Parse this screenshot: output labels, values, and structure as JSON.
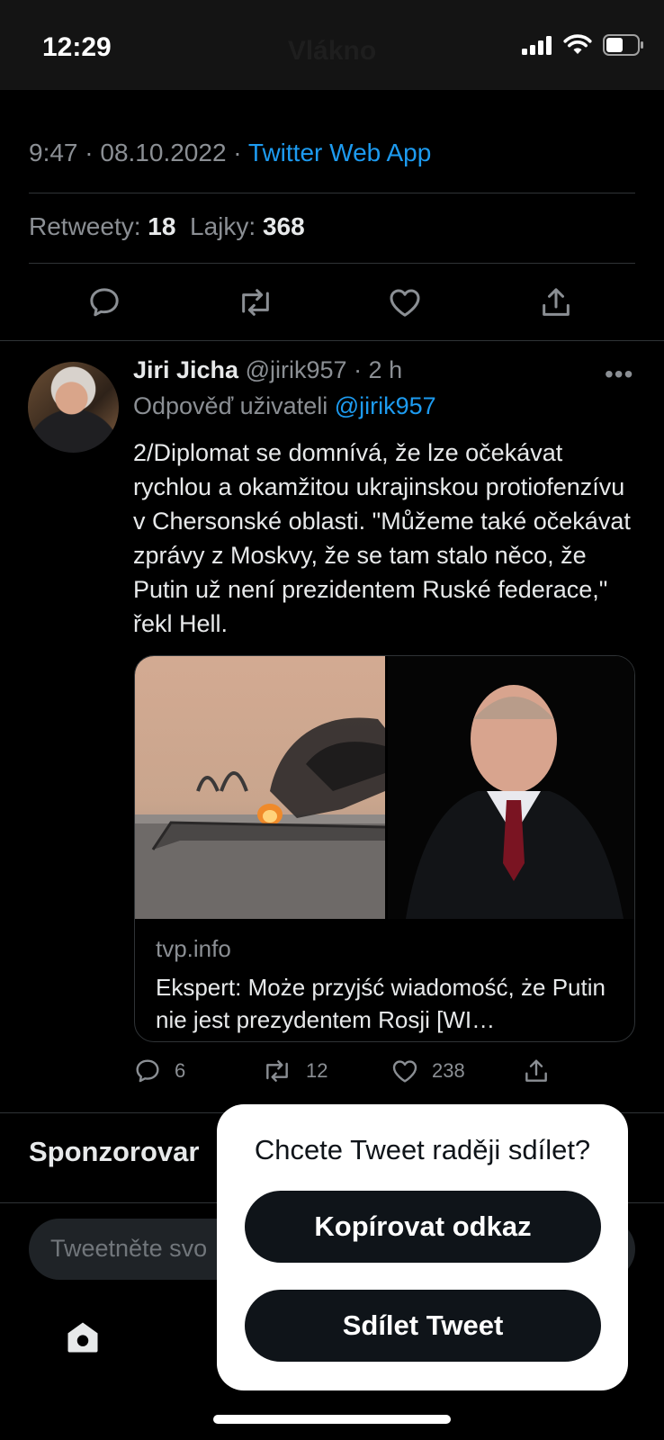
{
  "status_bar": {
    "time": "12:29",
    "nav_title": "Vlákno"
  },
  "tweet_meta": {
    "time_date": "9:47 · 08.10.2022 · ",
    "app": "Twitter Web App"
  },
  "stats": {
    "retweets_label": "Retweety: ",
    "retweets_count": "18",
    "likes_label": "Lajky: ",
    "likes_count": "368"
  },
  "reply": {
    "name": "Jiri Jicha",
    "handle": "@jirik957",
    "time": "· 2 h",
    "reply_prefix": "Odpověď uživateli ",
    "reply_handle": "@jirik957",
    "text": "2/Diplomat se domnívá, že lze očekávat rychlou a okamžitou ukrajinskou protiofenzívu v Chersonské oblasti. \"Můžeme také očekávat zprávy z Moskvy, že se tam stalo něco, že Putin už není prezidentem Ruské federace,\" řekl Hell.",
    "card": {
      "domain": "tvp.info",
      "title": "Ekspert: Może przyjść wiadomość, że Putin nie jest prezydentem Rosji [WI…"
    },
    "counts": {
      "replies": "6",
      "retweets": "12",
      "likes": "238"
    }
  },
  "sponsored_label": "Sponzorovar",
  "compose_placeholder": "Tweetněte svo",
  "share_sheet": {
    "title": "Chcete Tweet raději sdílet?",
    "copy_link": "Kopírovat odkaz",
    "share_tweet": "Sdílet Tweet"
  },
  "colors": {
    "accent": "#1d9bf0",
    "muted": "#8b8f94",
    "sheet_button": "#0f1419"
  },
  "icons": [
    "signal-icon",
    "wifi-icon",
    "battery-icon",
    "reply-icon",
    "retweet-icon",
    "like-icon",
    "share-icon",
    "more-icon",
    "home-icon"
  ]
}
